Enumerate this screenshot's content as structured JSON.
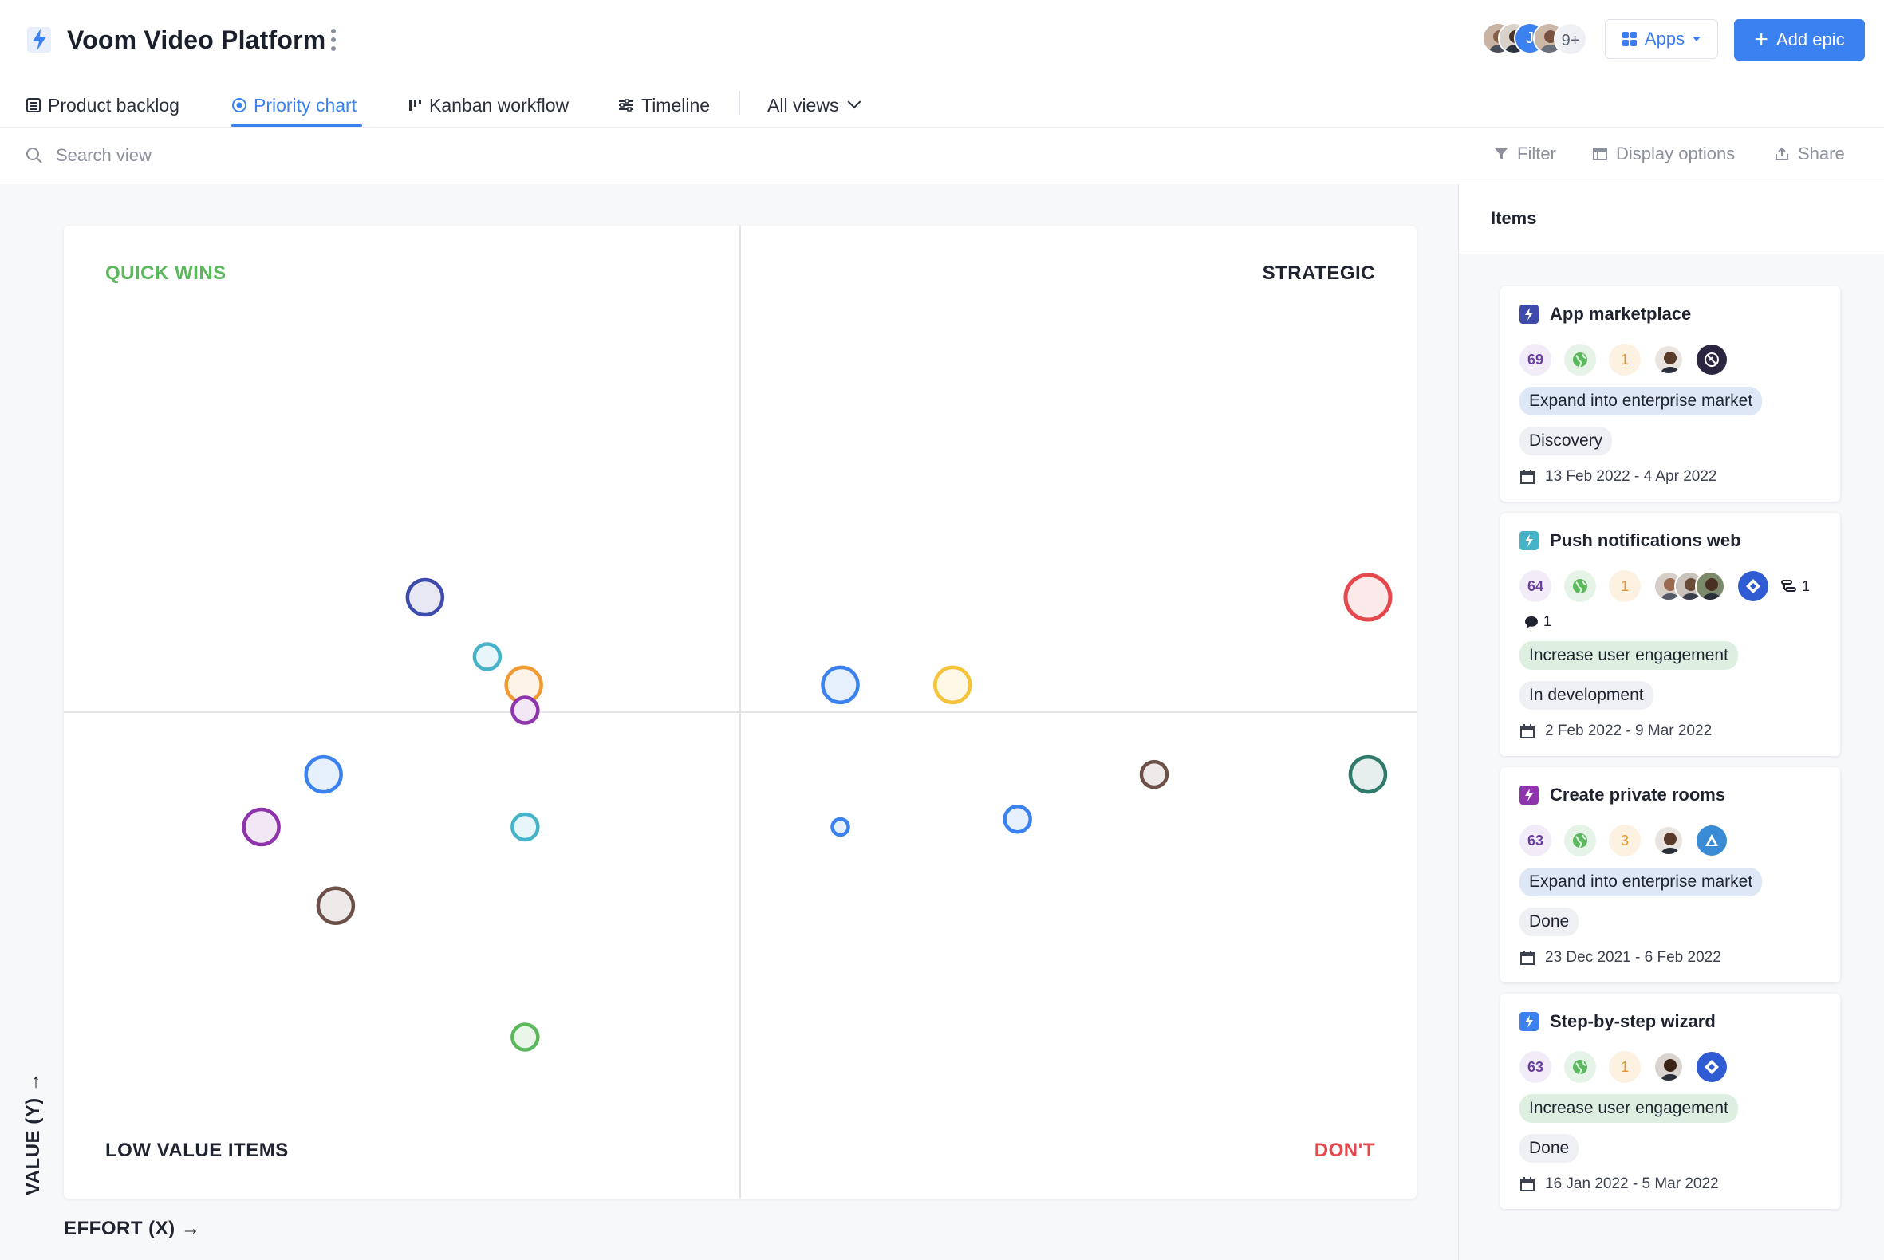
{
  "app": {
    "title": "Voom Video Platform",
    "icon": "lightning-bolt-icon",
    "accent": "#3b82f0"
  },
  "header": {
    "avatars_more": "9+",
    "avatar_letter": "J",
    "apps_label": "Apps",
    "add_label": "Add epic"
  },
  "tabs": [
    {
      "label": "Product backlog",
      "icon": "backlog-list-icon",
      "active": false
    },
    {
      "label": "Priority chart",
      "icon": "target-icon",
      "active": true
    },
    {
      "label": "Kanban workflow",
      "icon": "kanban-icon",
      "active": false
    },
    {
      "label": "Timeline",
      "icon": "timeline-icon",
      "active": false
    },
    {
      "label": "All views",
      "icon": "chevron-down-icon",
      "active": false
    }
  ],
  "toolbar": {
    "search_placeholder": "Search view",
    "filter_label": "Filter",
    "display_label": "Display options",
    "share_label": "Share"
  },
  "chart": {
    "quadrants": {
      "top_left": {
        "label": "QUICK WINS",
        "color": "#5cb85c"
      },
      "top_right": {
        "label": "STRATEGIC",
        "color": "#1f2330"
      },
      "bottom_left": {
        "label": "LOW VALUE ITEMS",
        "color": "#1f2330"
      },
      "bottom_right": {
        "label": "DON'T",
        "color": "#e5484d"
      }
    },
    "x_axis_label": "EFFORT (X) →",
    "y_axis_label": "VALUE (Y) →"
  },
  "chart_data": {
    "type": "scatter",
    "xlim": [
      0,
      100
    ],
    "ylim": [
      0,
      100
    ],
    "points": [
      {
        "x": 26.7,
        "y": 61.8,
        "size": 3,
        "color": "#3f4bab"
      },
      {
        "x": 31.3,
        "y": 55.7,
        "size": 2,
        "color": "#45b4c9"
      },
      {
        "x": 34.0,
        "y": 52.8,
        "size": 3,
        "color": "#f09a35"
      },
      {
        "x": 34.1,
        "y": 50.2,
        "size": 2,
        "color": "#8e35ad"
      },
      {
        "x": 19.2,
        "y": 43.6,
        "size": 3,
        "color": "#3b82f0"
      },
      {
        "x": 14.6,
        "y": 38.2,
        "size": 3,
        "color": "#8e35ad"
      },
      {
        "x": 34.1,
        "y": 38.2,
        "size": 2,
        "color": "#45b4c9"
      },
      {
        "x": 20.1,
        "y": 30.1,
        "size": 3,
        "color": "#6d5148"
      },
      {
        "x": 34.1,
        "y": 16.6,
        "size": 2,
        "color": "#5cb85c"
      },
      {
        "x": 57.4,
        "y": 52.8,
        "size": 3,
        "color": "#3b82f0"
      },
      {
        "x": 65.7,
        "y": 52.8,
        "size": 3,
        "color": "#f5c33b"
      },
      {
        "x": 96.4,
        "y": 61.8,
        "size": 4,
        "color": "#e5484d"
      },
      {
        "x": 80.6,
        "y": 43.6,
        "size": 2,
        "color": "#6d5148"
      },
      {
        "x": 96.4,
        "y": 43.6,
        "size": 3,
        "color": "#2f7a6a"
      },
      {
        "x": 57.4,
        "y": 38.2,
        "size": 1,
        "color": "#3b82f0"
      },
      {
        "x": 70.5,
        "y": 39.0,
        "size": 2,
        "color": "#3b82f0"
      }
    ]
  },
  "panel": {
    "title": "Items",
    "cards": [
      {
        "title": "App marketplace",
        "epic_color": "#3f4bab",
        "score": "69",
        "count": "1",
        "integration": "slack-like-icon",
        "goal": "Expand into enterprise market",
        "status": "Discovery",
        "dates": "13 Feb 2022 - 4 Apr 2022"
      },
      {
        "title": "Push notifications web",
        "epic_color": "#45b4c9",
        "score": "64",
        "count": "1",
        "integration": "jira-icon",
        "subtasks": "1",
        "comments": "1",
        "goal": "Increase user engagement",
        "status": "In development",
        "dates": "2 Feb 2022 - 9 Mar 2022"
      },
      {
        "title": "Create private rooms",
        "epic_color": "#8e35ad",
        "score": "63",
        "count": "3",
        "integration": "azure-icon",
        "goal": "Expand into enterprise market",
        "status": "Done",
        "dates": "23 Dec 2021 - 6 Feb 2022"
      },
      {
        "title": "Step-by-step wizard",
        "epic_color": "#3b82f0",
        "score": "63",
        "count": "1",
        "integration": "jira-icon",
        "goal": "Increase user engagement",
        "status": "Done",
        "dates": "16 Jan 2022 - 5 Mar 2022"
      }
    ]
  }
}
